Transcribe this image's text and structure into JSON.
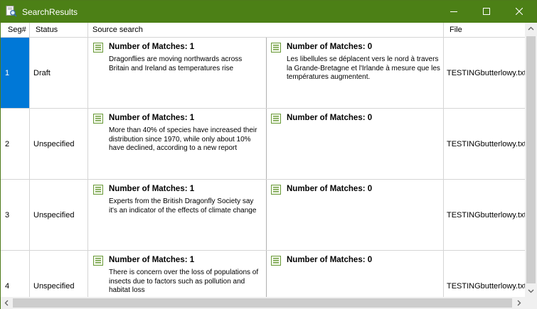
{
  "window": {
    "title": "SearchResults"
  },
  "columns": {
    "seg": "Seg#",
    "status": "Status",
    "source": "Source search",
    "file": "File"
  },
  "rows": [
    {
      "seg": "1",
      "status": "Draft",
      "left_title": "Number of Matches: 1",
      "left_text": "Dragonflies are moving northwards across Britain and Ireland as temperatures rise",
      "right_title": "Number of Matches: 0",
      "right_text": "Les libellules se déplacent vers le nord à travers la Grande-Bretagne et l'Irlande à mesure que les températures augmentent.",
      "file": "TESTINGbutterlowy.txt"
    },
    {
      "seg": "2",
      "status": "Unspecified",
      "left_title": "Number of Matches: 1",
      "left_text": "More than 40% of species have increased their distribution since 1970, while only about 10% have declined, according to a new report",
      "right_title": "Number of Matches: 0",
      "right_text": "",
      "file": "TESTINGbutterlowy.txt"
    },
    {
      "seg": "3",
      "status": "Unspecified",
      "left_title": "Number of Matches: 1",
      "left_text": "Experts from the British Dragonfly Society say it's an indicator of the effects of climate change",
      "right_title": "Number of Matches: 0",
      "right_text": "",
      "file": "TESTINGbutterlowy.txt"
    },
    {
      "seg": "4",
      "status": "Unspecified",
      "left_title": "Number of Matches: 1",
      "left_text": "There is concern over the loss of populations of insects due to factors such as pollution and habitat loss",
      "right_title": "Number of Matches: 0",
      "right_text": "",
      "file": "TESTINGbutterlowy.txt"
    }
  ],
  "icons": {
    "app": "search-document-icon",
    "minimize": "minimize-icon",
    "maximize": "maximize-icon",
    "close": "close-icon",
    "match": "document-list-icon"
  },
  "colors": {
    "titlebar": "#4c8016",
    "selection": "#0078d7",
    "grid_line": "#d5d5d5"
  }
}
